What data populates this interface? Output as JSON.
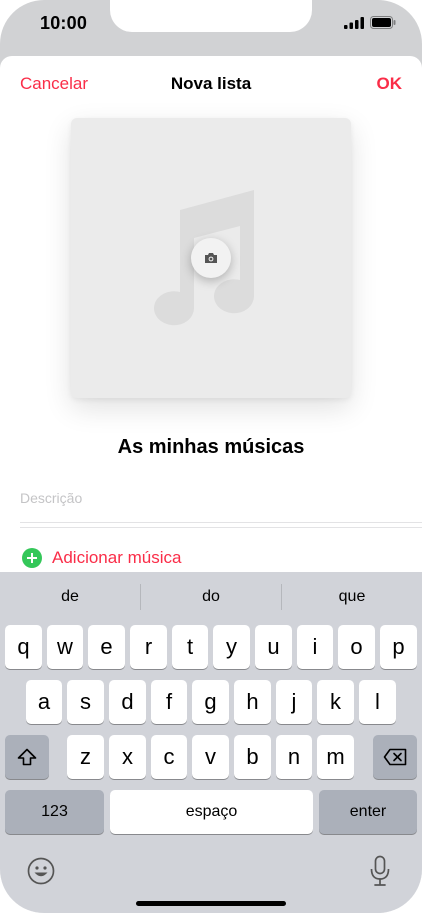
{
  "status_bar": {
    "time": "10:00"
  },
  "nav": {
    "cancel": "Cancelar",
    "title": "Nova lista",
    "done": "OK"
  },
  "playlist": {
    "name": "As minhas músicas",
    "description_placeholder": "Descrição",
    "add_music": "Adicionar música"
  },
  "keyboard": {
    "suggestions": [
      "de",
      "do",
      "que"
    ],
    "row1": [
      "q",
      "w",
      "e",
      "r",
      "t",
      "y",
      "u",
      "i",
      "o",
      "p"
    ],
    "row2": [
      "a",
      "s",
      "d",
      "f",
      "g",
      "h",
      "j",
      "k",
      "l"
    ],
    "row3": [
      "z",
      "x",
      "c",
      "v",
      "b",
      "n",
      "m"
    ],
    "numbers_key": "123",
    "space_key": "espaço",
    "enter_key": "enter"
  },
  "colors": {
    "accent": "#fa2d48",
    "add_icon": "#34c759",
    "keyboard_bg": "#d1d3d9",
    "function_key": "#abb0ba"
  },
  "icons": [
    "signal-icon",
    "battery-icon",
    "music-note-icon",
    "camera-icon",
    "plus-circle-icon",
    "shift-icon",
    "backspace-icon",
    "emoji-icon",
    "microphone-icon"
  ]
}
